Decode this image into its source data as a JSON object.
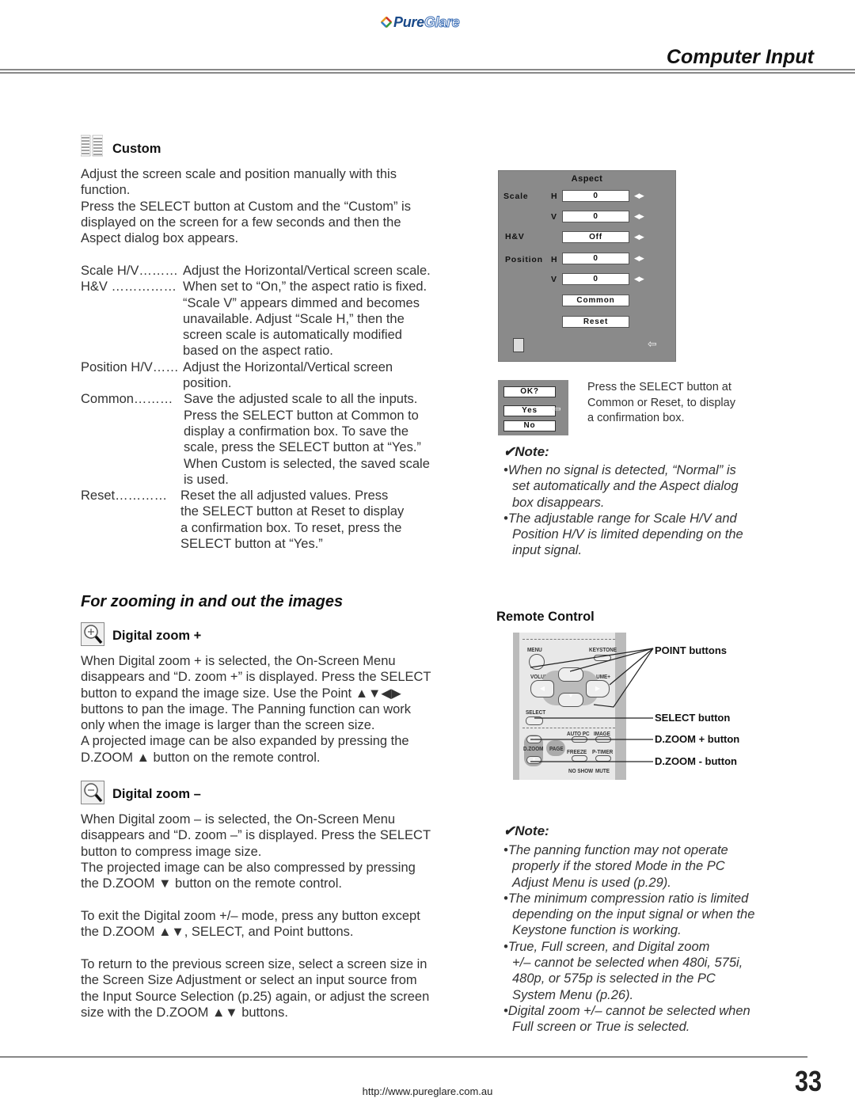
{
  "header": {
    "logo_part1": "Pure",
    "logo_part2": "Glare",
    "section_title": "Computer Input"
  },
  "custom": {
    "icon": "custom-grid-icon",
    "heading": "Custom",
    "intro": [
      "Adjust the screen scale and position manually with this",
      "function.",
      "Press the SELECT button at Custom and the “Custom” is",
      "displayed on the screen for a few seconds and then the",
      "Aspect dialog box appears."
    ],
    "definitions": [
      {
        "term": "Scale H/V………",
        "lines": [
          "Adjust the Horizontal/Vertical screen scale."
        ]
      },
      {
        "term": "H&V ……………",
        "lines": [
          "When set to “On,” the aspect ratio is fixed.",
          "“Scale V” appears dimmed and becomes",
          "unavailable. Adjust “Scale H,” then the",
          "screen scale is automatically modified",
          "based on the aspect ratio."
        ]
      },
      {
        "term": "Position H/V……",
        "lines": [
          "Adjust the Horizontal/Vertical screen",
          "position."
        ]
      },
      {
        "term": "Common……… ",
        "lines": [
          "Save the adjusted scale to all the inputs.",
          "Press the SELECT button at Common to",
          "display a confirmation box. To save the",
          "scale, press the SELECT button at “Yes.”",
          "When Custom is selected, the saved scale",
          "is used."
        ]
      },
      {
        "term": "Reset………… ",
        "lines": [
          "Reset the all adjusted values. Press",
          "the SELECT button at Reset to display",
          "a confirmation box. To reset, press the",
          "SELECT button at “Yes.”"
        ]
      }
    ]
  },
  "aspect_osd": {
    "title": "Aspect",
    "scale_label": "Scale",
    "h_label": "H",
    "v_label": "V",
    "hv_label": "H&V",
    "position_label": "Position",
    "scale_h_value": "0",
    "scale_v_value": "0",
    "hv_value": "Off",
    "position_h_value": "0",
    "position_v_value": "0",
    "common_button": "Common",
    "reset_button": "Reset",
    "arrows": "◀▶",
    "back_arrow": "⇦"
  },
  "confirm_box": {
    "title": "OK?",
    "yes": "Yes",
    "no": "No",
    "pointer": "⇦",
    "caption": [
      "Press the SELECT button at",
      "Common or Reset, to display",
      "a confirmation box."
    ]
  },
  "note1": {
    "heading": "✔Note:",
    "items": [
      [
        "•When no signal is detected, “Normal” is",
        "set automatically and the Aspect dialog",
        "box disappears."
      ],
      [
        "•The adjustable range for Scale H/V and",
        "Position H/V is limited depending on the",
        "input signal."
      ]
    ]
  },
  "zoom_section": {
    "heading": "For zooming in and out the images",
    "zoom_in": {
      "heading": "Digital zoom +",
      "lines": [
        "When Digital zoom + is selected, the On-Screen Menu",
        "disappears and “D. zoom +” is displayed. Press the SELECT",
        "button to expand the image size. Use the Point ▲▼◀▶",
        "buttons to pan the image. The Panning function can work",
        "only when the image is larger than the screen size.",
        "A projected image can be also expanded by pressing the",
        "D.ZOOM ▲ button on the remote control."
      ]
    },
    "zoom_out": {
      "heading": "Digital zoom –",
      "lines": [
        "When Digital zoom – is selected, the On-Screen Menu",
        "disappears and “D. zoom –” is displayed. Press the SELECT",
        "button to compress image size.",
        "The projected image can be also compressed by pressing",
        "the D.ZOOM ▼ button on the remote control."
      ]
    },
    "exit_text": [
      "To exit the Digital zoom +/– mode, press any button except",
      "the D.ZOOM ▲▼, SELECT, and Point buttons."
    ],
    "return_text": [
      "To return to the previous screen size, select a screen size in",
      "the Screen Size Adjustment or select an input source from",
      "the Input Source Selection (p.25) again, or adjust the screen",
      "size with the D.ZOOM ▲▼ buttons."
    ]
  },
  "remote": {
    "heading": "Remote Control",
    "labels": {
      "menu": "MENU",
      "keystone": "KEYSTONE",
      "volume_minus": "VOLUME-",
      "volume_plus": "VOLUME+",
      "select": "SELECT",
      "auto_pc": "AUTO PC",
      "image": "IMAGE",
      "dzoom": "D.ZOOM",
      "page": "PAGE",
      "freeze": "FREEZE",
      "ptimer": "P-TIMER",
      "no_show": "NO SHOW",
      "mute": "MUTE"
    },
    "callouts": {
      "point": "POINT buttons",
      "select": "SELECT button",
      "dzoom_plus": "D.ZOOM + button",
      "dzoom_minus": "D.ZOOM - button"
    }
  },
  "note2": {
    "heading": "✔Note:",
    "items": [
      [
        "•The panning function may not operate",
        "properly if the stored Mode in the PC",
        "Adjust Menu is used (p.29)."
      ],
      [
        "•The minimum compression ratio is limited",
        "depending on the input signal or when the",
        "Keystone function is working."
      ],
      [
        "•True, Full screen, and Digital zoom",
        "+/– cannot be selected when 480i, 575i,",
        "480p, or 575p is selected in the PC",
        "System Menu (p.26)."
      ],
      [
        "•Digital zoom +/– cannot be selected when",
        "Full screen or True is selected."
      ]
    ]
  },
  "footer": {
    "url": "http://www.pureglare.com.au",
    "page_number": "33"
  }
}
